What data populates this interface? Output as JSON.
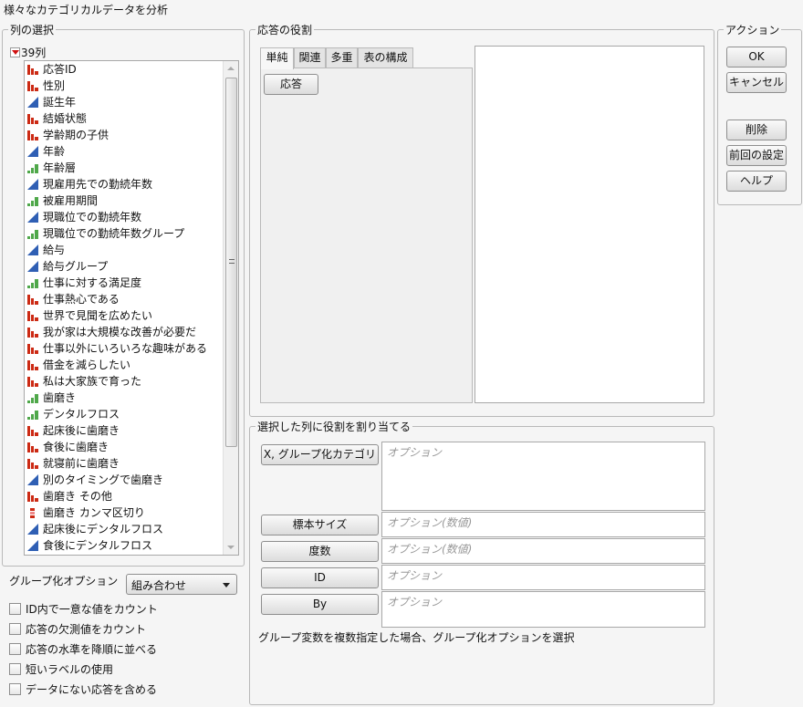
{
  "window_title": "様々なカテゴリカルデータを分析",
  "column_selection": {
    "label": "列の選択",
    "count_label": "39列",
    "columns": [
      {
        "name": "応答ID",
        "type": "nominal"
      },
      {
        "name": "性別",
        "type": "nominal"
      },
      {
        "name": "誕生年",
        "type": "continuous"
      },
      {
        "name": "結婚状態",
        "type": "nominal"
      },
      {
        "name": "学齢期の子供",
        "type": "nominal"
      },
      {
        "name": "年齢",
        "type": "continuous"
      },
      {
        "name": "年齢層",
        "type": "ordinal"
      },
      {
        "name": "現雇用先での勤続年数",
        "type": "continuous"
      },
      {
        "name": "被雇用期間",
        "type": "ordinal"
      },
      {
        "name": "現職位での勤続年数",
        "type": "continuous"
      },
      {
        "name": "現職位での勤続年数グループ",
        "type": "ordinal"
      },
      {
        "name": "給与",
        "type": "continuous"
      },
      {
        "name": "給与グループ",
        "type": "continuous"
      },
      {
        "name": "仕事に対する満足度",
        "type": "ordinal"
      },
      {
        "name": "仕事熱心である",
        "type": "nominal"
      },
      {
        "name": "世界で見聞を広めたい",
        "type": "nominal"
      },
      {
        "name": "我が家は大規模な改善が必要だ",
        "type": "nominal"
      },
      {
        "name": "仕事以外にいろいろな趣味がある",
        "type": "nominal"
      },
      {
        "name": "借金を減らしたい",
        "type": "nominal"
      },
      {
        "name": "私は大家族で育った",
        "type": "nominal"
      },
      {
        "name": "歯磨き",
        "type": "ordinal"
      },
      {
        "name": "デンタルフロス",
        "type": "ordinal"
      },
      {
        "name": "起床後に歯磨き",
        "type": "nominal"
      },
      {
        "name": "食後に歯磨き",
        "type": "nominal"
      },
      {
        "name": "就寝前に歯磨き",
        "type": "nominal"
      },
      {
        "name": "別のタイミングで歯磨き",
        "type": "continuous"
      },
      {
        "name": "歯磨き その他",
        "type": "nominal"
      },
      {
        "name": "歯磨き カンマ区切り",
        "type": "multiple"
      },
      {
        "name": "起床後にデンタルフロス",
        "type": "continuous"
      },
      {
        "name": "食後にデンタルフロス",
        "type": "continuous"
      }
    ]
  },
  "grouping": {
    "label": "グループ化オプション",
    "selected": "組み合わせ"
  },
  "checkboxes": [
    {
      "label": "ID内で一意な値をカウント",
      "checked": false
    },
    {
      "label": "応答の欠測値をカウント",
      "checked": false
    },
    {
      "label": "応答の水準を降順に並べる",
      "checked": false
    },
    {
      "label": "短いラベルの使用",
      "checked": false
    },
    {
      "label": "データにない応答を含める",
      "checked": false
    }
  ],
  "response_roles": {
    "label": "応答の役割",
    "tabs": [
      "単純",
      "関連",
      "多重",
      "表の構成"
    ],
    "active_tab": "単純",
    "response_button": "応答"
  },
  "assign_roles": {
    "label": "選択した列に役割を割り当てる",
    "roles": [
      {
        "button": "X, グループ化カテゴリ",
        "placeholder": "オプション"
      },
      {
        "button": "標本サイズ",
        "placeholder": "オプション(数値)"
      },
      {
        "button": "度数",
        "placeholder": "オプション(数値)"
      },
      {
        "button": "ID",
        "placeholder": "オプション"
      },
      {
        "button": "By",
        "placeholder": "オプション"
      }
    ],
    "note": "グループ変数を複数指定した場合、グループ化オプションを選択"
  },
  "actions": {
    "label": "アクション",
    "ok": "OK",
    "cancel": "キャンセル",
    "remove": "削除",
    "recall": "前回の設定",
    "help": "ヘルプ"
  },
  "colors": {
    "nominal": "#cc2a14",
    "continuous": "#2f5fb4",
    "ordinal": "#4fa84a"
  }
}
